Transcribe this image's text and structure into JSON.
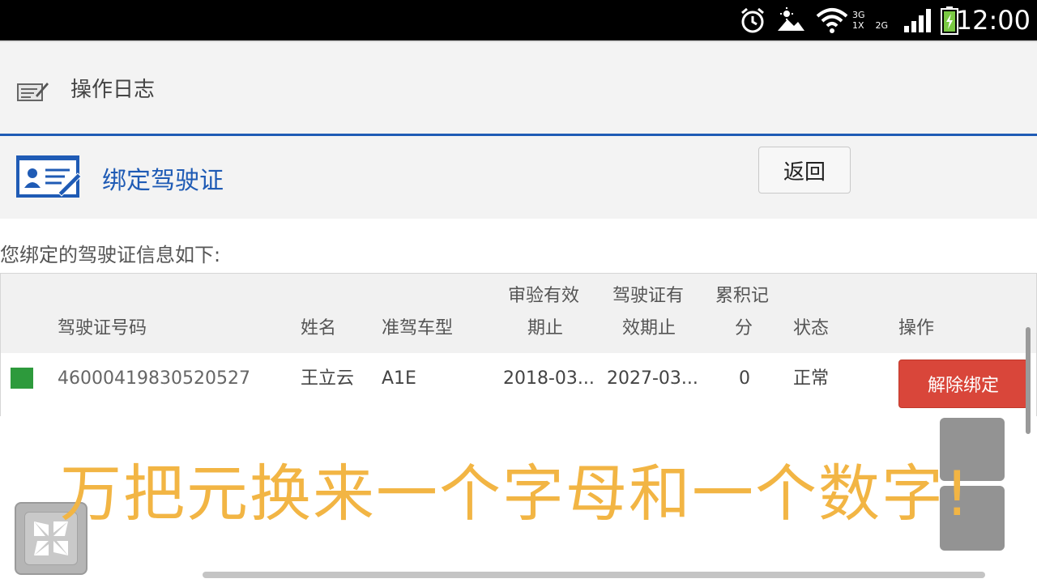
{
  "status_bar": {
    "time": "12:00",
    "network_top": "3G",
    "network_bottom": "1X",
    "network_bottom2": "2G",
    "icons": [
      "alarm-icon",
      "weather-icon",
      "wifi-icon",
      "signal-icon",
      "battery-icon"
    ]
  },
  "log_header": {
    "title": "操作日志",
    "icon": "log-icon"
  },
  "bind_section": {
    "title": "绑定驾驶证",
    "icon": "license-card-icon",
    "back_label": "返回"
  },
  "intro_text": "您绑定的驾驶证信息如下:",
  "table": {
    "headers": {
      "license_no": "驾驶证号码",
      "name": "姓名",
      "vehicle_type": "准驾车型",
      "inspect_line1": "审验有效",
      "inspect_line2": "期止",
      "valid_line1": "驾驶证有",
      "valid_line2": "效期止",
      "points_line1": "累积记",
      "points_line2": "分",
      "status": "状态",
      "action": "操作"
    },
    "rows": [
      {
        "license_no": "46000419830520527",
        "name": "王立云",
        "vehicle_type": "A1E",
        "inspect_date": "2018-03...",
        "valid_date": "2027-03...",
        "points": "0",
        "status": "正常",
        "action_label": "解除绑定"
      }
    ]
  },
  "subtitle_overlay": "万把元换来一个字母和一个数字!",
  "colors": {
    "accent_blue": "#1f5bb5",
    "status_green": "#2d9a3c",
    "danger_red": "#d9463a",
    "subtitle_yellow": "#f2b544"
  }
}
